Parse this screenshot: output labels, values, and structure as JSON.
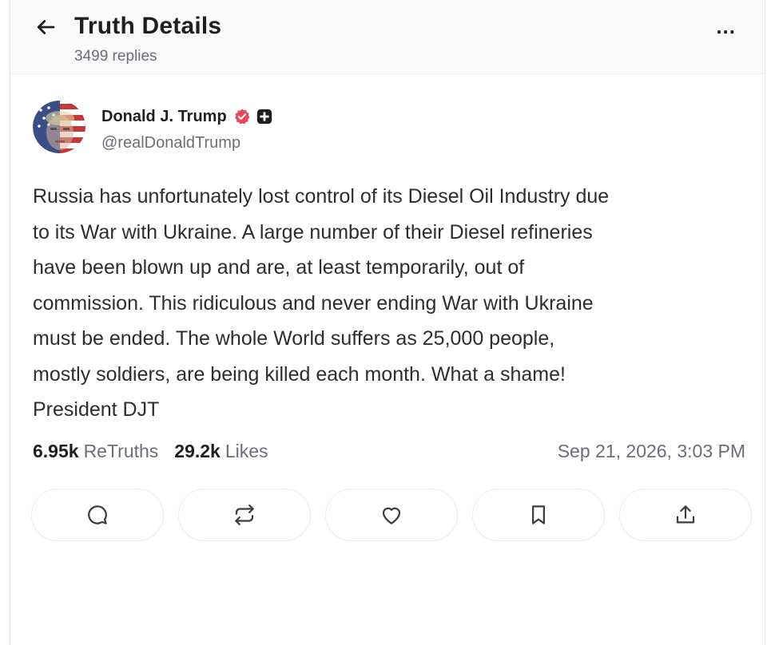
{
  "header": {
    "title": "Truth Details",
    "replies": "3499 replies",
    "back_icon": "arrow-left-icon",
    "more_label": "..."
  },
  "post": {
    "author": {
      "name": "Donald J. Trump",
      "handle": "@realDonaldTrump",
      "verified_color": "#e8465b",
      "badge_color": "#1f1f23"
    },
    "text": "Russia has unfortunately lost control of its Diesel Oil Industry due\nto its War with Ukraine. A large number of their Diesel refineries\nhave been blown up and are, at least temporarily, out of\ncommission. This ridiculous and never ending War with Ukraine\nmust be ended. The whole World suffers as 25,000 people,\nmostly soldiers, are being killed each month. What a shame!\nPresident DJT",
    "stats": {
      "retruths_count": "6.95k",
      "retruths_label": "ReTruths",
      "likes_count": "29.2k",
      "likes_label": "Likes"
    },
    "timestamp": "Sep 21, 2026, 3:03 PM"
  },
  "actions": [
    {
      "icon": "reply-icon"
    },
    {
      "icon": "retruth-icon"
    },
    {
      "icon": "heart-icon"
    },
    {
      "icon": "bookmark-icon"
    },
    {
      "icon": "share-icon"
    }
  ]
}
